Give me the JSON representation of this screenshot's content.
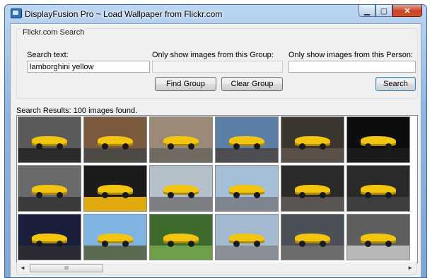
{
  "window": {
    "title": "DisplayFusion Pro ~ Load Wallpaper from Flickr.com",
    "minimize_icon": "minimize-icon",
    "maximize_icon": "maximize-icon",
    "close_icon": "close-icon"
  },
  "search_group": {
    "title": "Flickr.com Search",
    "search_text_label": "Search text:",
    "search_text_value": "lamborghini yellow",
    "group_label": "Only show images from this Group:",
    "group_value": "",
    "person_label": "Only show images from this Person:",
    "person_value": "",
    "find_group_button": "Find Group",
    "clear_group_button": "Clear Group",
    "search_button": "Search"
  },
  "results": {
    "label": "Search Results: 100 images found.",
    "thumbnails": [
      {
        "bg": "#5a5a5a",
        "ground": "#2b2b2b"
      },
      {
        "bg": "#7c5a3e",
        "ground": "#4e4a46"
      },
      {
        "bg": "#9b8a78",
        "ground": "#6f6a62"
      },
      {
        "bg": "#5b7fa6",
        "ground": "#4d4d52"
      },
      {
        "bg": "#3b3630",
        "ground": "#5a5048"
      },
      {
        "bg": "#0d0d0d",
        "ground": "#1a1a1a"
      },
      {
        "bg": "#6a6a6a",
        "ground": "#3b3b3b"
      },
      {
        "bg": "#1b1b1b",
        "ground": "#e0a90c"
      },
      {
        "bg": "#b3bfc9",
        "ground": "#7c7f84"
      },
      {
        "bg": "#a6bfd8",
        "ground": "#7e858e"
      },
      {
        "bg": "#2c2a29",
        "ground": "#5a5550"
      },
      {
        "bg": "#2a2a2a",
        "ground": "#3e3e3e"
      },
      {
        "bg": "#1b1e3a",
        "ground": "#2a2a35"
      },
      {
        "bg": "#7fb3e0",
        "ground": "#5a6b52"
      },
      {
        "bg": "#3e6a2b",
        "ground": "#6ea04a"
      },
      {
        "bg": "#a2b9cf",
        "ground": "#8a8f96"
      },
      {
        "bg": "#4b4f58",
        "ground": "#6c6c6c"
      },
      {
        "bg": "#5e5e5e",
        "ground": "#b8b8b8"
      }
    ]
  },
  "scrollbar": {
    "left_arrow": "◄",
    "right_arrow": "►",
    "grip": "III"
  }
}
